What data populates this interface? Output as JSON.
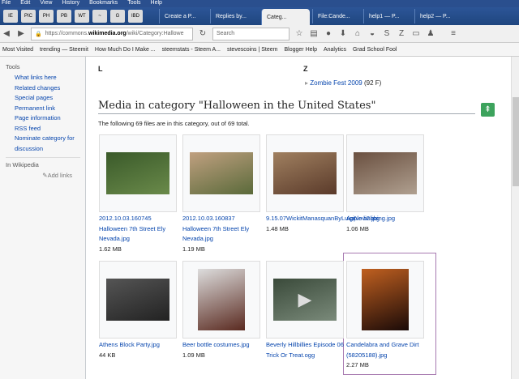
{
  "menu": [
    "File",
    "Edit",
    "View",
    "History",
    "Bookmarks",
    "Tools",
    "Help"
  ],
  "tabs": [
    {
      "label": "Create a P..."
    },
    {
      "label": "Replies by..."
    },
    {
      "label": "Categ...",
      "active": true
    },
    {
      "label": "File:Cande..."
    },
    {
      "label": "help1 — P..."
    },
    {
      "label": "help2 — P..."
    }
  ],
  "pinned": [
    "IE",
    "PIC",
    "PH",
    "PB",
    "WT",
    "~",
    "G",
    "IBD"
  ],
  "nav": {
    "url_prefix": "https://commons.",
    "url_domain": "wikimedia.org",
    "url_path": "/wiki/Category:Hallowe",
    "search_placeholder": "Search"
  },
  "bookmarks": [
    "Most Visited",
    "trending — Steemit",
    "How Much Do I Make ...",
    "steemstats - Steem A...",
    "stevescoins | Steem",
    "Blogger Help",
    "Analytics",
    "Grad School Fool"
  ],
  "sidebar": {
    "tools_heading": "Tools",
    "links": [
      "What links here",
      "Related changes",
      "Special pages",
      "Permanent link",
      "Page information",
      "RSS feed",
      "Nominate category for discussion"
    ],
    "wikipedia_heading": "In Wikipedia",
    "add_links": "Add links"
  },
  "main": {
    "letter_l": "L",
    "letter_z": "Z",
    "zombie_link": "Zombie Fest 2009",
    "zombie_count": "(92 F)",
    "heading": "Media in category \"Halloween in the United States\"",
    "intro": "The following 69 files are in this category, out of 69 total.",
    "files": [
      {
        "name": "2012.10.03.160745 Halloween 7th Street Ely Nevada.jpg",
        "size": "1.62 MB",
        "colors": [
          "#6a8a4a",
          "#3a5a2a"
        ]
      },
      {
        "name": "2012.10.03.160837 Halloween 7th Street Ely Nevada.jpg",
        "size": "1.19 MB",
        "colors": [
          "#5a6a3a",
          "#c0a080"
        ]
      },
      {
        "name": "9.15.07WickitManasquanByLuigiNovi2.jpg",
        "size": "1.48 MB",
        "colors": [
          "#5a3a2a",
          "#a08060"
        ]
      },
      {
        "name": "Apple bobbing.jpg",
        "size": "1.06 MB",
        "colors": [
          "#b0a090",
          "#6a5040"
        ]
      },
      {
        "name": "Athens Block Party.jpg",
        "size": "44 KB",
        "colors": [
          "#222",
          "#555"
        ]
      },
      {
        "name": "Beer bottle costumes.jpg",
        "size": "1.09 MB",
        "colors": [
          "#5a2a20",
          "#ddd"
        ]
      },
      {
        "name": "Beverly Hillbillies Episode 06 Trick Or Treat.ogg",
        "size": "",
        "colors": [
          "#7a8a7a",
          "#3a4a3a"
        ]
      },
      {
        "name": "Candelabra and Grave Dirt (58205188).jpg",
        "size": "2.27 MB",
        "colors": [
          "#1a0a08",
          "#c06020"
        ]
      }
    ]
  }
}
